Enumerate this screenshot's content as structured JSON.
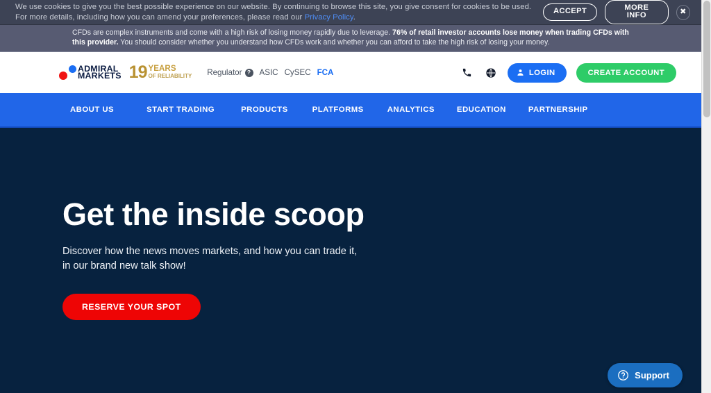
{
  "cookie_banner": {
    "text_part1": "We use cookies to give you the best possible experience on our website. By continuing to browse this site, you give consent for cookies to be used. For more details, including how you can amend your preferences, please read our ",
    "privacy_link": "Privacy Policy",
    "text_part2": ".",
    "accept_label": "ACCEPT",
    "more_info_label": "MORE INFO",
    "close_label": "✖",
    "bg_color": "#3d4355"
  },
  "risk_warning": {
    "part1": "CFDs are complex instruments and come with a high risk of losing money rapidly due to leverage. ",
    "bold": "76% of retail investor accounts lose money when trading CFDs with this provider.",
    "part2": " You should consider whether you understand how CFDs work and whether you can afford to take the high risk of losing your money.",
    "bg_color": "#575b72"
  },
  "header": {
    "logo": {
      "line1": "ADMIRAL",
      "line2": "MARKETS",
      "years_number": "19",
      "years_word": "YEARS",
      "years_sub": "OF RELIABILITY",
      "dot_blue_color": "#1b6ef3",
      "dot_red_color": "#f01414",
      "gold_color": "#b99232"
    },
    "regulator": {
      "label": "Regulator",
      "help_glyph": "?",
      "items": [
        {
          "label": "ASIC",
          "active": false
        },
        {
          "label": "CySEC",
          "active": false
        },
        {
          "label": "FCA",
          "active": true
        }
      ],
      "active_color": "#1b6ef3"
    },
    "phone_icon": "phone-icon",
    "globe_icon": "globe-icon",
    "login_label": "LOGIN",
    "login_color": "#1b6ef3",
    "create_account_label": "CREATE ACCOUNT",
    "create_account_color": "#2ecc68"
  },
  "nav": {
    "bg_color": "#2166e8",
    "items": [
      {
        "label": "ABOUT US"
      },
      {
        "label": "START TRADING"
      },
      {
        "label": "PRODUCTS"
      },
      {
        "label": "PLATFORMS"
      },
      {
        "label": "ANALYTICS"
      },
      {
        "label": "EDUCATION"
      },
      {
        "label": "PARTNERSHIP"
      }
    ]
  },
  "hero": {
    "bg_color": "#07223f",
    "title": "Get the inside scoop",
    "subtitle_line1": "Discover how the news moves markets, and how you can trade it,",
    "subtitle_line2": "in our brand new talk show!",
    "cta_label": "RESERVE YOUR SPOT",
    "cta_color": "#ee0505"
  },
  "support_widget": {
    "label": "Support",
    "icon": "question-circle-icon",
    "bg_color": "#1b6ec0"
  }
}
